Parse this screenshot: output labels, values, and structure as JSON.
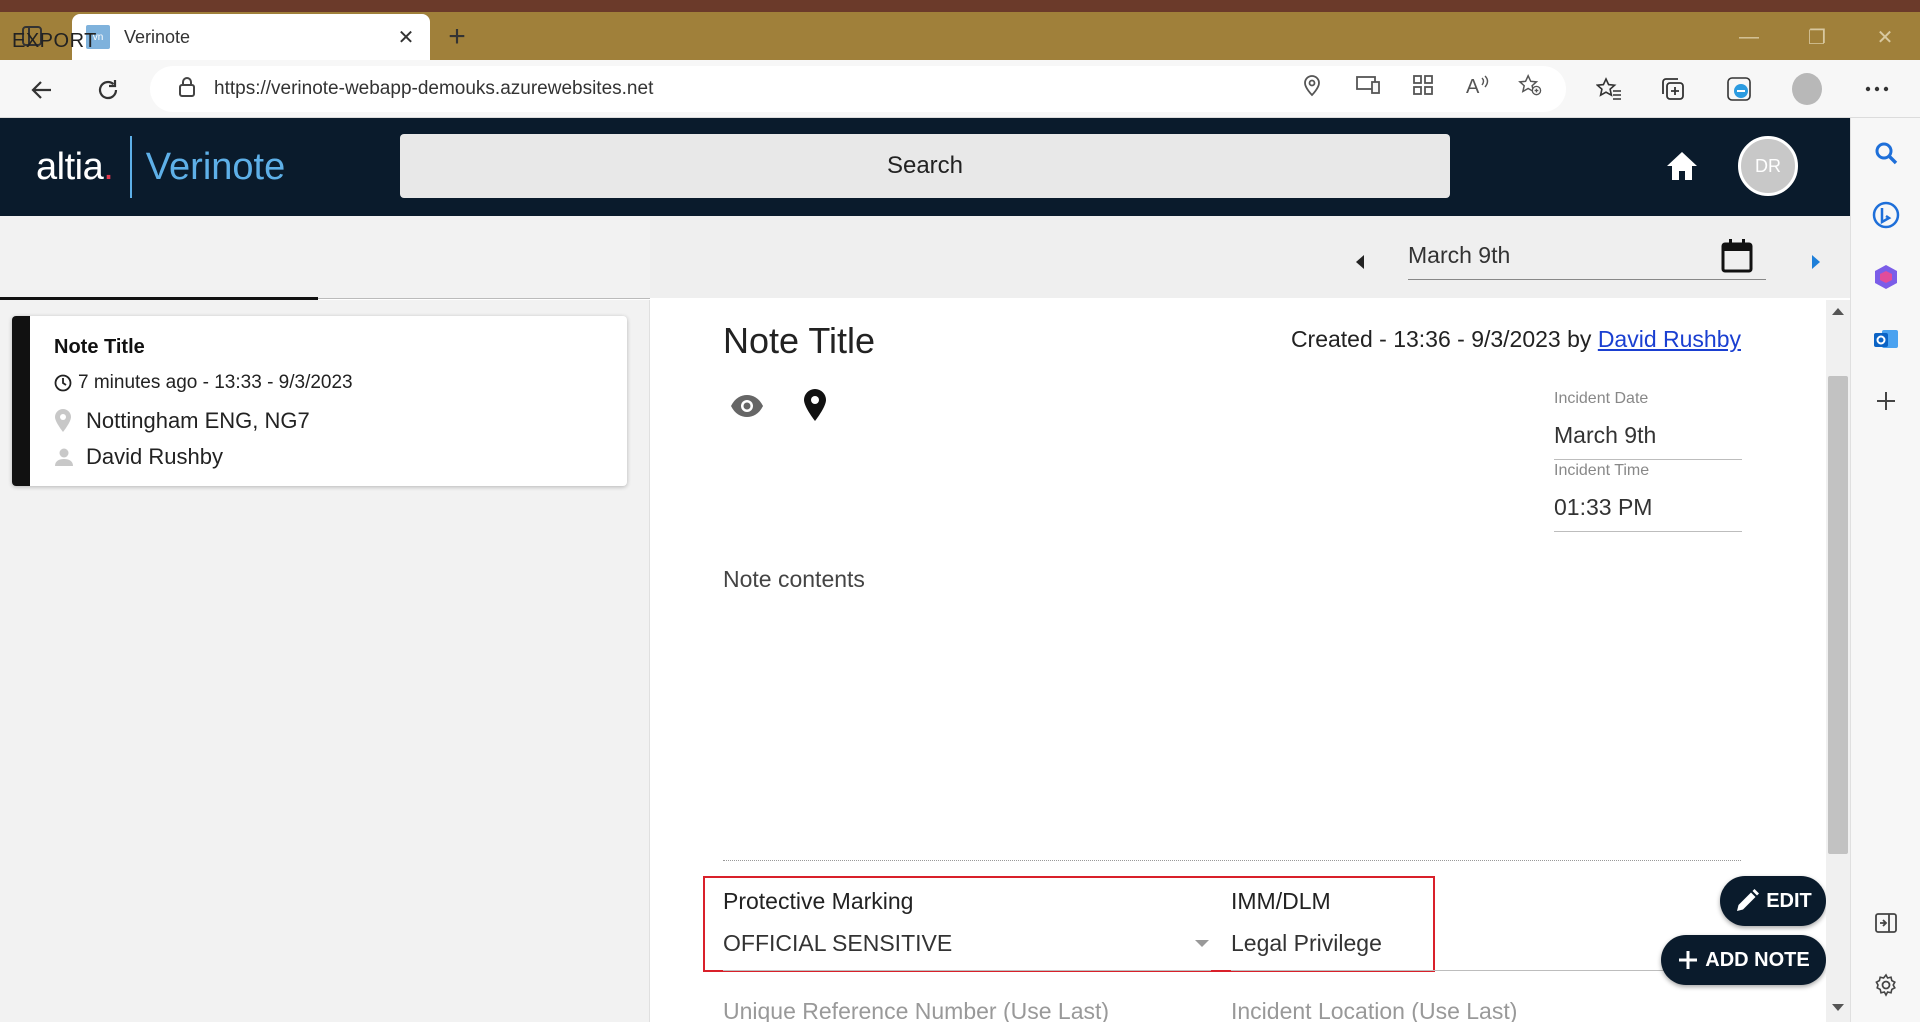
{
  "browser": {
    "tab_title": "Verinote",
    "favicon_text": "vn",
    "url": "https://verinote-webapp-demouks.azurewebsites.net",
    "icons": [
      "tab-actions-icon",
      "close-icon",
      "plus-icon",
      "back-icon",
      "refresh-icon",
      "lock-icon",
      "location-icon",
      "cast-icon",
      "apps-icon",
      "read-aloud-icon",
      "add-favorite-icon",
      "favorites-icon",
      "collections-icon",
      "edge-icon",
      "profile-icon",
      "more-icon"
    ]
  },
  "edge_sidebar": {
    "icons": [
      "search-icon",
      "bing-icon",
      "office-icon",
      "outlook-icon",
      "plus-icon",
      "split-screen-icon",
      "settings-icon"
    ]
  },
  "header": {
    "logo_brand": "altia",
    "logo_product": "Verinote",
    "search_label": "Search",
    "avatar_initials": "DR"
  },
  "toolbar": {
    "export_label": "EXPORT",
    "date_value": "March 9th"
  },
  "note_list": [
    {
      "title": "Note Title",
      "time": "7 minutes ago - 13:33 - 9/3/2023",
      "location": "Nottingham ENG, NG7",
      "author": "David Rushby"
    }
  ],
  "note": {
    "title": "Note Title",
    "created_prefix": "Created - 13:36 - 9/3/2023 by ",
    "created_by": "David Rushby",
    "incident_date_label": "Incident Date",
    "incident_date_value": "March 9th",
    "incident_time_label": "Incident Time",
    "incident_time_value": "01:33 PM",
    "contents": "Note contents",
    "protective_marking_label": "Protective Marking",
    "protective_marking_value": "OFFICIAL SENSITIVE",
    "imm_label": "IMM/DLM",
    "imm_value": "Legal Privilege",
    "urn_label": "Unique Reference Number  (Use Last)",
    "location_label": "Incident Location  (Use Last)"
  },
  "actions": {
    "edit_label": "EDIT",
    "add_note_label": "ADD NOTE"
  },
  "colors": {
    "header_bg": "#0a1b2c",
    "brand_blue": "#5eb0e8",
    "highlight_red": "#d9202a",
    "link_blue": "#1a3fd1"
  }
}
